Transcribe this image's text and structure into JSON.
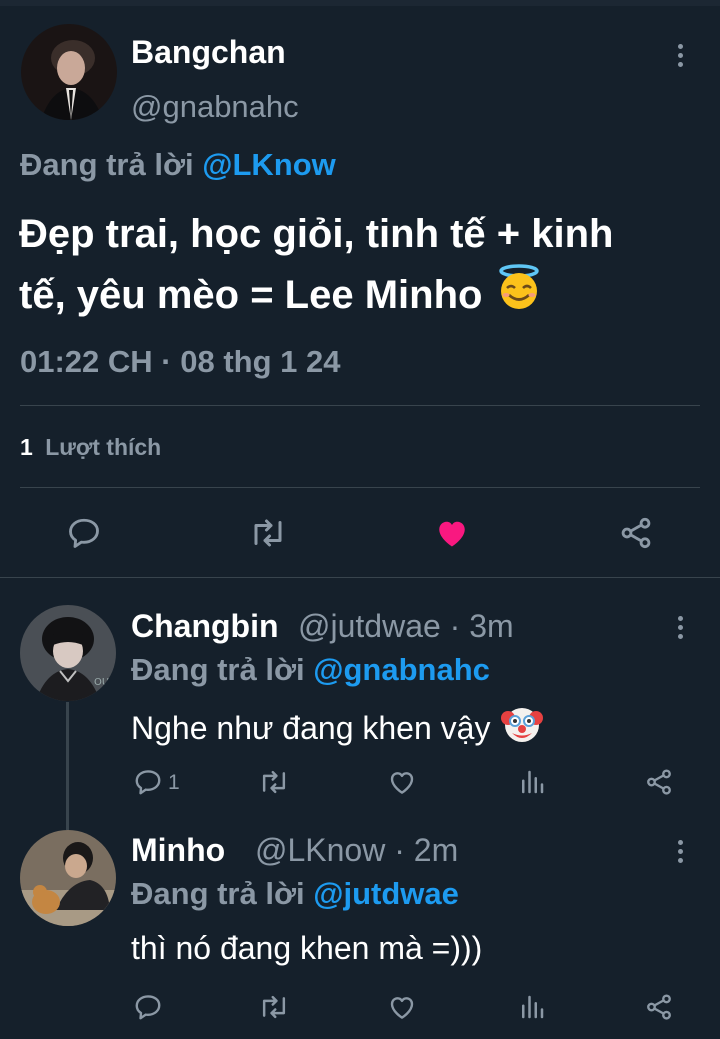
{
  "main_tweet": {
    "author_name": "Bangchan",
    "author_handle": "@gnabnahc",
    "replying_prefix": "Đang trả lời",
    "replying_to": "@LKnow",
    "text_line1": "Đẹp trai, học giỏi, tinh tế + kinh",
    "text_line2": "tế, yêu mèo = Lee Minho",
    "emoji": "smiling-face-with-halo",
    "timestamp": "01:22 CH · 08 thg 1 24",
    "likes_count": "1",
    "likes_label": "Lượt thích",
    "liked": true
  },
  "replies": [
    {
      "author_name": "Changbin",
      "author_handle": "@jutdwae · 3m",
      "replying_prefix": "Đang trả lời",
      "replying_to": "@gnabnahc",
      "text": "Nghe như đang khen vậy",
      "emoji": "clown-face",
      "reply_count": "1"
    },
    {
      "author_name": "Minho",
      "author_handle": "@LKnow · 2m",
      "replying_prefix": "Đang trả lời",
      "replying_to": "@jutdwae",
      "text": "thì nó đang khen mà =)))",
      "reply_count": ""
    }
  ],
  "colors": {
    "background": "#15202b",
    "secondary_text": "#8b98a5",
    "mention": "#1d9bf0",
    "like": "#f91880",
    "divider": "#38444d"
  }
}
